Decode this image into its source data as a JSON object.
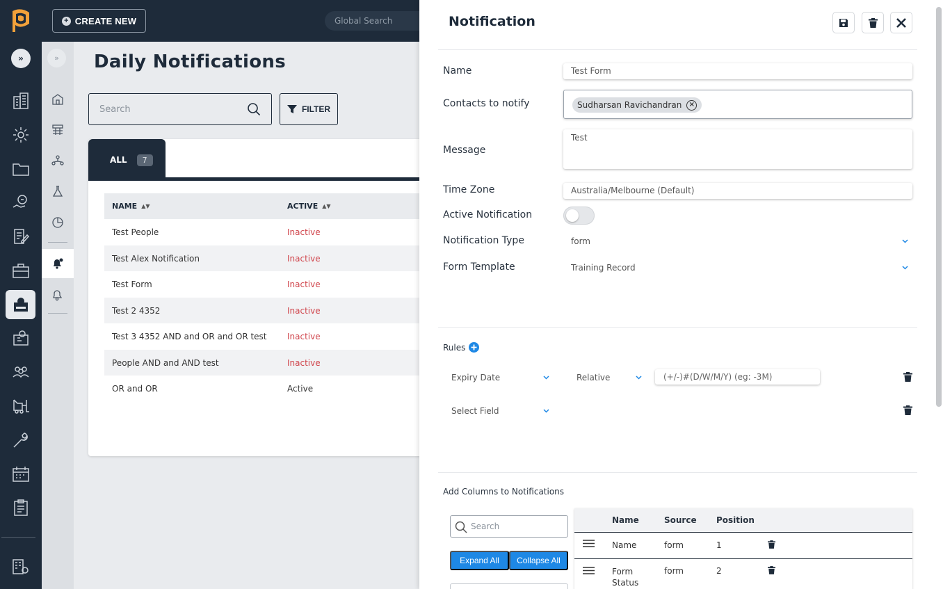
{
  "topbar": {
    "create_label": "CREATE NEW",
    "global_search_placeholder": "Global Search"
  },
  "main": {
    "title": "Daily Notifications",
    "search_placeholder": "Search",
    "filter_label": "FILTER",
    "tab_all_label": "ALL",
    "tab_all_count": "7",
    "columns": [
      "NAME",
      "ACTIVE"
    ],
    "rows": [
      {
        "name": "Test People",
        "active": "Inactive"
      },
      {
        "name": "Test Alex Notification",
        "active": "Inactive"
      },
      {
        "name": "Test Form",
        "active": "Inactive"
      },
      {
        "name": "Test 2 4352",
        "active": "Inactive"
      },
      {
        "name": "Test 3 4352 AND and OR and OR test",
        "active": "Inactive"
      },
      {
        "name": "People AND and AND test",
        "active": "Inactive"
      },
      {
        "name": "OR and OR",
        "active": "Active"
      }
    ]
  },
  "panel": {
    "title": "Notification",
    "labels": {
      "name": "Name",
      "contacts": "Contacts to notify",
      "message": "Message",
      "timezone": "Time Zone",
      "active": "Active Notification",
      "type": "Notification Type",
      "template": "Form Template"
    },
    "values": {
      "name": "Test Form",
      "contact_chip": "Sudharsan Ravichandran",
      "message": "Test",
      "timezone": "Australia/Melbourne (Default)",
      "type": "form",
      "template": "Training Record"
    },
    "rules_label": "Rules",
    "rule1_field": "Expiry Date",
    "rule1_mode": "Relative",
    "rule1_placeholder": "(+/-)#(D/W/M/Y) (eg: -3M)",
    "rule2_field": "Select Field",
    "add_columns_label": "Add Columns to Notifications",
    "columns_search_placeholder": "Search",
    "expand_all": "Expand All",
    "collapse_all": "Collapse All",
    "col_table_headers": [
      "Name",
      "Source",
      "Position"
    ],
    "col_rows": [
      {
        "name": "Name",
        "source": "form",
        "position": "1"
      },
      {
        "name": "Form Status",
        "source": "form",
        "position": "2"
      }
    ]
  },
  "colors": {
    "navy": "#1e2b3a",
    "inactive_red": "#d0454c",
    "accent_blue": "#1e88e5"
  }
}
